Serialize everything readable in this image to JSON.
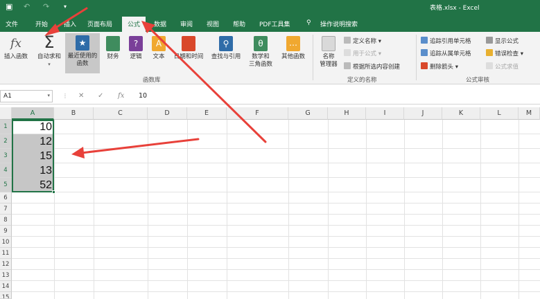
{
  "window": {
    "title": "表格.xlsx - Excel",
    "quick_access": [
      "save-icon",
      "undo-icon",
      "redo-icon",
      "customize-icon"
    ]
  },
  "tabs": [
    {
      "label": "文件"
    },
    {
      "label": "开始"
    },
    {
      "label": "插入"
    },
    {
      "label": "页面布局"
    },
    {
      "label": "公式",
      "active": true
    },
    {
      "label": "数据"
    },
    {
      "label": "审阅"
    },
    {
      "label": "视图"
    },
    {
      "label": "帮助"
    },
    {
      "label": "PDF工具集"
    },
    {
      "label": "操作说明搜索"
    }
  ],
  "ribbon": {
    "function_library": {
      "group_label": "函数库",
      "insert_function": "插入函数",
      "autosum": "自动求和",
      "recent_line1": "最近使用的",
      "recent_line2": "函数",
      "financial": "财务",
      "logical": "逻辑",
      "text": "文本",
      "datetime": "日期和时间",
      "lookup": "查找与引用",
      "math_line1": "数学和",
      "math_line2": "三角函数",
      "other": "其他函数"
    },
    "defined_names": {
      "group_label": "定义的名称",
      "name_manager_line1": "名称",
      "name_manager_line2": "管理器",
      "define_name": "定义名称",
      "use_in_formula": "用于公式",
      "create_from_selection": "根据所选内容创建"
    },
    "formula_auditing": {
      "group_label": "公式审核",
      "trace_precedents": "追踪引用单元格",
      "trace_dependents": "追踪从属单元格",
      "remove_arrows": "删除箭头",
      "show_formulas": "显示公式",
      "error_checking": "错误检查",
      "evaluate_formula": "公式求值"
    }
  },
  "formula_bar": {
    "name_box": "A1",
    "value": "10",
    "cancel_glyph": "✕",
    "enter_glyph": "✓",
    "fx_glyph": "fx"
  },
  "sheet": {
    "columns": [
      "A",
      "B",
      "C",
      "D",
      "E",
      "F",
      "G",
      "H",
      "I",
      "J",
      "K",
      "L",
      "M"
    ],
    "rows": [
      "1",
      "2",
      "3",
      "4",
      "5",
      "6",
      "7",
      "8",
      "9",
      "10",
      "11",
      "12",
      "13",
      "14",
      "15"
    ],
    "cells": {
      "A1": "10",
      "A2": "12",
      "A3": "15",
      "A4": "13",
      "A5": "52"
    },
    "selection": "A1:A5"
  },
  "colors": {
    "accent": "#217346",
    "annotation_arrow": "#e8413a"
  }
}
